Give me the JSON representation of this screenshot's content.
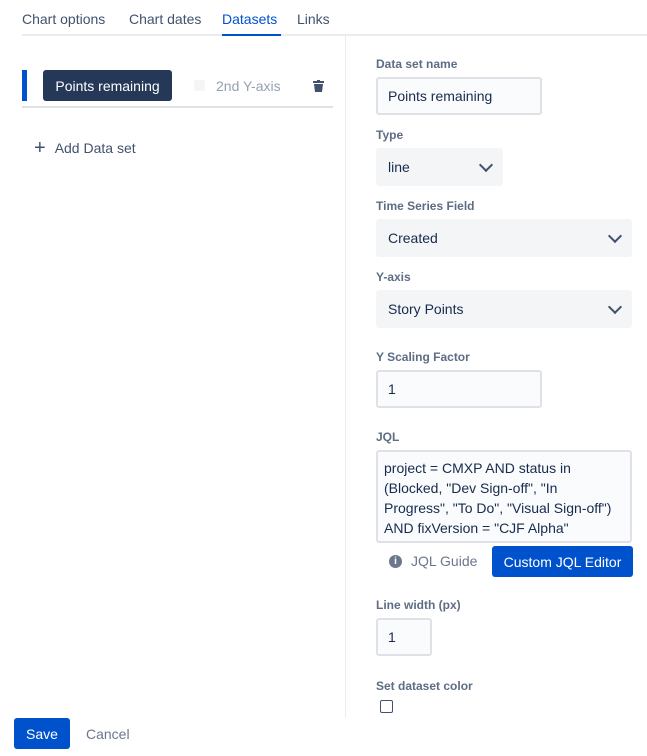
{
  "tabs": [
    {
      "label": "Chart options"
    },
    {
      "label": "Chart dates"
    },
    {
      "label": "Datasets"
    },
    {
      "label": "Links"
    }
  ],
  "active_tab": "Datasets",
  "dataset": {
    "name_button": "Points remaining",
    "second_axis_label": "2nd Y-axis",
    "second_axis_checked": false
  },
  "add_dataset_label": "Add Data set",
  "form": {
    "name_label": "Data set name",
    "name_value": "Points remaining",
    "type_label": "Type",
    "type_value": "line",
    "time_field_label": "Time Series Field",
    "time_field_value": "Created",
    "yaxis_label": "Y-axis",
    "yaxis_value": "Story Points",
    "scaling_label": "Y Scaling Factor",
    "scaling_value": "1",
    "jql_label": "JQL",
    "jql_value": "project = CMXP AND status in (Blocked, \"Dev Sign-off\", \"In Progress\", \"To Do\", \"Visual Sign-off\") AND fixVersion = \"CJF Alpha\"",
    "jql_guide_label": "JQL Guide",
    "jql_editor_label": "Custom JQL Editor",
    "line_width_label": "Line width (px)",
    "line_width_value": "1",
    "color_label": "Set dataset color",
    "color_checked": false
  },
  "footer": {
    "save_label": "Save",
    "cancel_label": "Cancel"
  },
  "colors": {
    "accent": "#0052cc",
    "dataset_button": "#253858"
  }
}
